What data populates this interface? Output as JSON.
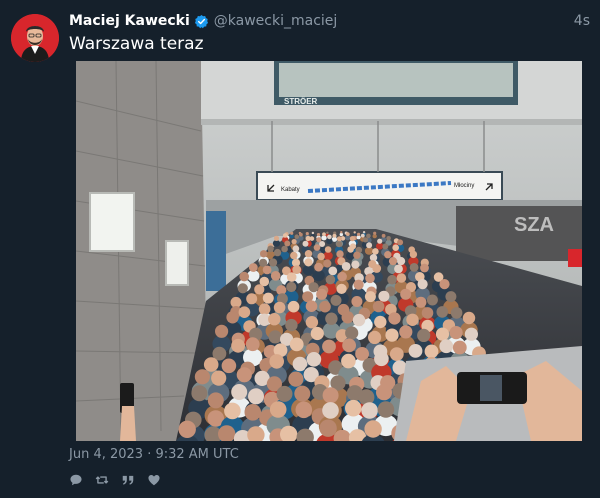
{
  "tweet": {
    "author_name": "Maciej Kawecki",
    "handle": "@kawecki_maciej",
    "relative_time": "4s",
    "text": "Warszawa teraz",
    "date": "Jun 4, 2023 · 9:32 AM UTC",
    "verified": true
  },
  "media": {
    "ad_sign": "STRÖER",
    "left_direction": "Kabaty",
    "right_direction": "Młociny",
    "wall_text": "SZA"
  },
  "actions": [
    "reply-icon",
    "retweet-icon",
    "quote-icon",
    "like-icon"
  ],
  "colors": {
    "background": "#15202b",
    "verified": "#1d9bf0",
    "muted": "#8b98a5",
    "avatar_bg": "#d8262c"
  }
}
